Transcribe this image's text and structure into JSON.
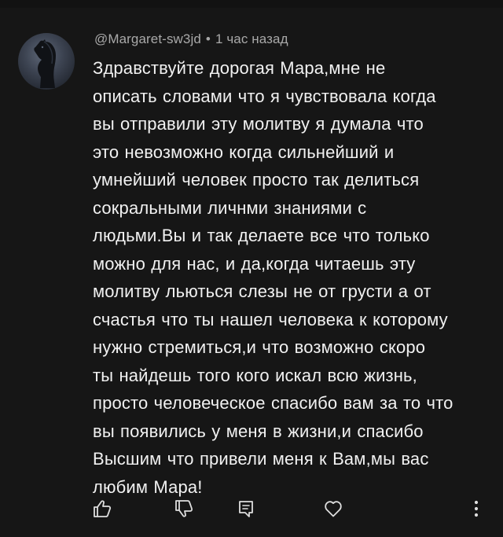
{
  "comment": {
    "author": "@Margaret-sw3jd",
    "separator": "•",
    "time": "1 час назад",
    "text": "Здравствуйте дорогая Мара,мне не\nописать словами что я чувствовала когда\nвы отправили эту молитву я думала что\nэто невозможно когда сильнейший и\nумнейший человек просто так делиться\nсокральными личнми знаниями с\nлюдьми.Вы и так делаете все что только\nможно для нас, и да,когда читаешь эту\nмолитву льються слезы не от грусти а от\nсчастья что ты нашел человека к которому\nнужно стремиться,и что возможно скоро\nты найдешь того кого искал всю жизнь,\nпросто человеческое спасибо вам за то что\nвы появились у меня в жизни,и спасибо\nВысшим что привели меня к Вам,мы вас\nлюбим Мара!"
  },
  "avatar_icon": "horse-silhouette-icon",
  "actions": {
    "like_icon": "thumbs-up-icon",
    "dislike_icon": "thumbs-down-icon",
    "reply_icon": "reply-comment-icon",
    "heart_icon": "heart-icon",
    "more_icon": "more-vertical-icon"
  },
  "colors": {
    "background": "#161616",
    "text_primary": "#f1f1f1",
    "text_secondary": "#a9a9a9",
    "icon": "#dedede"
  }
}
